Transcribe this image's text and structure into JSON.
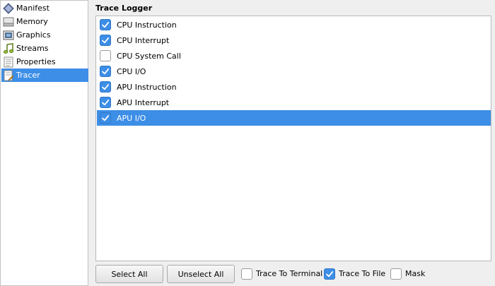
{
  "sidebar": {
    "items": [
      {
        "label": "Manifest",
        "icon": "manifest-icon",
        "selected": false
      },
      {
        "label": "Memory",
        "icon": "memory-icon",
        "selected": false
      },
      {
        "label": "Graphics",
        "icon": "graphics-icon",
        "selected": false
      },
      {
        "label": "Streams",
        "icon": "music-note-icon",
        "selected": false
      },
      {
        "label": "Properties",
        "icon": "document-icon",
        "selected": false
      },
      {
        "label": "Tracer",
        "icon": "tracer-icon",
        "selected": true
      }
    ]
  },
  "trace_logger": {
    "title": "Trace Logger",
    "items": [
      {
        "label": "CPU Instruction",
        "checked": true,
        "selected": false
      },
      {
        "label": "CPU Interrupt",
        "checked": true,
        "selected": false
      },
      {
        "label": "CPU System Call",
        "checked": false,
        "selected": false
      },
      {
        "label": "CPU I/O",
        "checked": true,
        "selected": false
      },
      {
        "label": "APU Instruction",
        "checked": true,
        "selected": false
      },
      {
        "label": "APU Interrupt",
        "checked": true,
        "selected": false
      },
      {
        "label": "APU I/O",
        "checked": true,
        "selected": true
      }
    ]
  },
  "buttons": {
    "select_all": "Select All",
    "unselect_all": "Unselect All"
  },
  "options": {
    "trace_to_terminal": {
      "label": "Trace To Terminal",
      "checked": false
    },
    "trace_to_file": {
      "label": "Trace To File",
      "checked": true
    },
    "mask": {
      "label": "Mask",
      "checked": false
    }
  },
  "colors": {
    "accent": "#3d8ee6"
  }
}
